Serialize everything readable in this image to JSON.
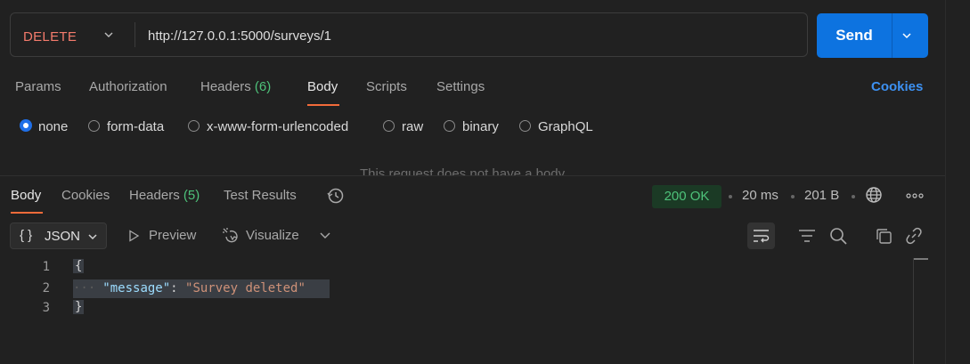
{
  "request": {
    "method": "DELETE",
    "url": "http://127.0.0.1:5000/surveys/1",
    "send_label": "Send"
  },
  "request_tabs": {
    "params": "Params",
    "authorization": "Authorization",
    "headers": "Headers",
    "headers_count": "(6)",
    "body": "Body",
    "scripts": "Scripts",
    "settings": "Settings",
    "cookies": "Cookies"
  },
  "body_types": {
    "none": "none",
    "form_data": "form-data",
    "urlencoded": "x-www-form-urlencoded",
    "raw": "raw",
    "binary": "binary",
    "graphql": "GraphQL",
    "selected": "none"
  },
  "no_body_text": "This request does not have a body",
  "response_tabs": {
    "body": "Body",
    "cookies": "Cookies",
    "headers": "Headers",
    "headers_count": "(5)",
    "test_results": "Test Results"
  },
  "response_meta": {
    "status": "200 OK",
    "time": "20 ms",
    "size": "201 B"
  },
  "response_toolbar": {
    "format_brace": "{ }",
    "format": "JSON",
    "preview": "Preview",
    "visualize": "Visualize"
  },
  "response_body": {
    "line_numbers": [
      "1",
      "2",
      "3"
    ],
    "open_brace": "{",
    "close_brace": "}",
    "key": "\"message\"",
    "colon": ": ",
    "value": "\"Survey deleted\""
  },
  "colors": {
    "accent": "#f26b3a",
    "send_blue": "#0d73e0",
    "method_red": "#f47b6c",
    "status_green": "#4ec27a",
    "link_blue": "#3d91f2"
  },
  "icons": [
    "chevron-down-icon",
    "history-icon",
    "globe-icon",
    "more-horizontal-icon",
    "play-icon",
    "visualize-icon",
    "wrap-lines-icon",
    "filter-icon",
    "search-icon",
    "copy-icon",
    "link-icon"
  ]
}
